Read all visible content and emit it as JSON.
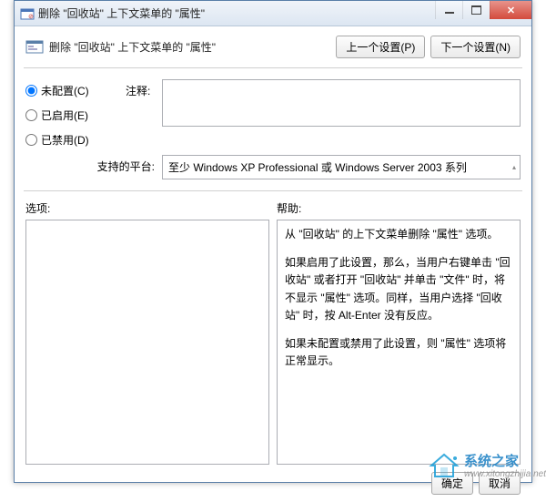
{
  "titlebar": {
    "text": "删除 \"回收站\" 上下文菜单的 \"属性\""
  },
  "header": {
    "title": "删除 \"回收站\" 上下文菜单的 \"属性\"",
    "prev_button": "上一个设置(P)",
    "next_button": "下一个设置(N)"
  },
  "radios": {
    "not_configured": "未配置(C)",
    "enabled": "已启用(E)",
    "disabled": "已禁用(D)"
  },
  "comment": {
    "label": "注释:",
    "value": ""
  },
  "platform": {
    "label": "支持的平台:",
    "value": "至少 Windows XP Professional 或 Windows Server 2003 系列"
  },
  "options": {
    "label": "选项:"
  },
  "help": {
    "label": "帮助:",
    "p1": "从 \"回收站\" 的上下文菜单删除 \"属性\" 选项。",
    "p2": "如果启用了此设置，那么，当用户右键单击 \"回收站\" 或者打开 \"回收站\" 并单击 \"文件\" 时，将不显示 \"属性\" 选项。同样，当用户选择 \"回收站\" 时，按 Alt-Enter 没有反应。",
    "p3": "如果未配置或禁用了此设置，则 \"属性\" 选项将正常显示。"
  },
  "footer": {
    "ok": "确定",
    "cancel": "取消"
  },
  "watermark": {
    "title": "系统之家",
    "url": "www.xitongzhijia.net"
  }
}
